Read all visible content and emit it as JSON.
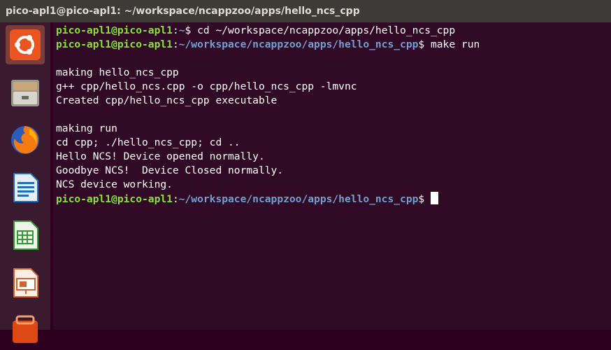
{
  "window": {
    "title": "pico-apl1@pico-apl1: ~/workspace/ncappzoo/apps/hello_ncs_cpp"
  },
  "launcher": {
    "items": [
      {
        "icon": "ubuntu-dash-icon",
        "color": "#e95420"
      },
      {
        "icon": "file-manager-icon",
        "color": "#8e8a7f"
      },
      {
        "icon": "firefox-icon",
        "color": "#e66000"
      },
      {
        "icon": "libreoffice-writer-icon",
        "color": "#1e6fc0"
      },
      {
        "icon": "libreoffice-calc-icon",
        "color": "#2f9e2f"
      },
      {
        "icon": "libreoffice-impress-icon",
        "color": "#d1642c"
      },
      {
        "icon": "software-center-icon",
        "color": "#dd4814"
      }
    ]
  },
  "terminal": {
    "prompt_user": "pico-apl1@pico-apl1",
    "line1": {
      "sep": ":",
      "path": "~",
      "suffix": "$ cd ~/workspace/ncappzoo/apps/hello_ncs_cpp"
    },
    "line2": {
      "sep": ":",
      "path": "~/workspace/ncappzoo/apps/hello_ncs_cpp",
      "suffix": "$ make run"
    },
    "out1": "making hello_ncs_cpp",
    "out2": "g++ cpp/hello_ncs.cpp -o cpp/hello_ncs_cpp -lmvnc",
    "out3": "Created cpp/hello_ncs_cpp executable",
    "out4": "making run",
    "out5": "cd cpp; ./hello_ncs_cpp; cd ..",
    "out6": "Hello NCS! Device opened normally.",
    "out7": "Goodbye NCS!  Device Closed normally.",
    "out8": "NCS device working.",
    "line3": {
      "sep": ":",
      "path": "~/workspace/ncappzoo/apps/hello_ncs_cpp",
      "suffix": "$ "
    },
    "colors": {
      "background": "#300a24",
      "user": "#8ae234",
      "path": "#729fcf",
      "text": "#ffffff"
    }
  }
}
